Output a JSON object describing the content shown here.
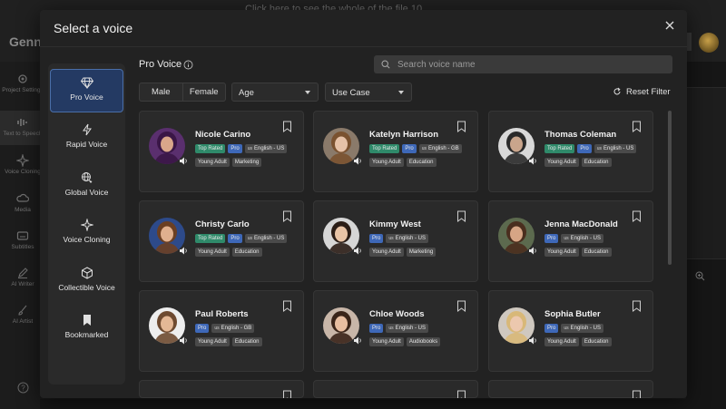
{
  "background": {
    "brand": "Genn",
    "top_text": "Click here to see the whole of the file 10",
    "sidebar": [
      {
        "label": "Project Settings",
        "icon": "gear-icon"
      },
      {
        "label": "Text to Speech",
        "icon": "waveform-icon"
      },
      {
        "label": "Voice Cloning",
        "icon": "sparkle-icon"
      },
      {
        "label": "Media",
        "icon": "cloud-icon"
      },
      {
        "label": "Subtitles",
        "icon": "subtitles-icon"
      },
      {
        "label": "AI Writer",
        "icon": "pen-icon"
      },
      {
        "label": "AI Artist",
        "icon": "brush-icon"
      }
    ]
  },
  "modal": {
    "title": "Select a voice",
    "section_title": "Pro Voice",
    "search_placeholder": "Search voice name",
    "filters": {
      "gender": [
        "Male",
        "Female"
      ],
      "age_label": "Age",
      "use_case_label": "Use Case",
      "reset_label": "Reset Filter"
    },
    "categories": [
      {
        "label": "Pro Voice",
        "icon": "diamond-icon",
        "active": true
      },
      {
        "label": "Rapid Voice",
        "icon": "lightning-icon",
        "active": false
      },
      {
        "label": "Global Voice",
        "icon": "globe-icon",
        "active": false
      },
      {
        "label": "Voice Cloning",
        "icon": "sparkle-icon",
        "active": false
      },
      {
        "label": "Collectible Voice",
        "icon": "cube-icon",
        "active": false
      },
      {
        "label": "Bookmarked",
        "icon": "bookmark-icon",
        "active": false
      }
    ],
    "voices": [
      {
        "name": "Nicole Carino",
        "top_rated": "Top Rated",
        "tier": "Pro",
        "language": "English - US",
        "age": "Young Adult",
        "use_case": "Marketing",
        "bg": "#5a2f6e",
        "hair": "#3a1646",
        "skin": "#d9a68a"
      },
      {
        "name": "Katelyn Harrison",
        "top_rated": "Top Rated",
        "tier": "Pro",
        "language": "English - GB",
        "age": "Young Adult",
        "use_case": "Education",
        "bg": "#8a7a6a",
        "hair": "#7a5230",
        "skin": "#e6c2a8"
      },
      {
        "name": "Thomas Coleman",
        "top_rated": "Top Rated",
        "tier": "Pro",
        "language": "English - US",
        "age": "Young Adult",
        "use_case": "Education",
        "bg": "#d8d8d8",
        "hair": "#2a2a2a",
        "skin": "#c9a58c"
      },
      {
        "name": "Christy Carlo",
        "top_rated": "Top Rated",
        "tier": "Pro",
        "language": "English - US",
        "age": "Young Adult",
        "use_case": "Education",
        "bg": "#2d4a8a",
        "hair": "#6b3f22",
        "skin": "#e0b08e"
      },
      {
        "name": "Kimmy West",
        "top_rated": "",
        "tier": "Pro",
        "language": "English - US",
        "age": "Young Adult",
        "use_case": "Marketing",
        "bg": "#d6d6d6",
        "hair": "#2b1d16",
        "skin": "#e9c4a6"
      },
      {
        "name": "Jenna MacDonald",
        "top_rated": "",
        "tier": "Pro",
        "language": "English - US",
        "age": "Young Adult",
        "use_case": "Education",
        "bg": "#5c6a4e",
        "hair": "#4a2e1e",
        "skin": "#d6a585"
      },
      {
        "name": "Paul Roberts",
        "top_rated": "",
        "tier": "Pro",
        "language": "English - GB",
        "age": "Young Adult",
        "use_case": "Education",
        "bg": "#eeeeee",
        "hair": "#6e4a30",
        "skin": "#e4b896"
      },
      {
        "name": "Chloe Woods",
        "top_rated": "",
        "tier": "Pro",
        "language": "English - US",
        "age": "Young Adult",
        "use_case": "Audiobooks",
        "bg": "#c8b6a8",
        "hair": "#3a2418",
        "skin": "#e8bea0"
      },
      {
        "name": "Sophia Butler",
        "top_rated": "",
        "tier": "Pro",
        "language": "English - US",
        "age": "Young Adult",
        "use_case": "Education",
        "bg": "#cfc8bf",
        "hair": "#d8b878",
        "skin": "#ecc8ae"
      }
    ]
  }
}
